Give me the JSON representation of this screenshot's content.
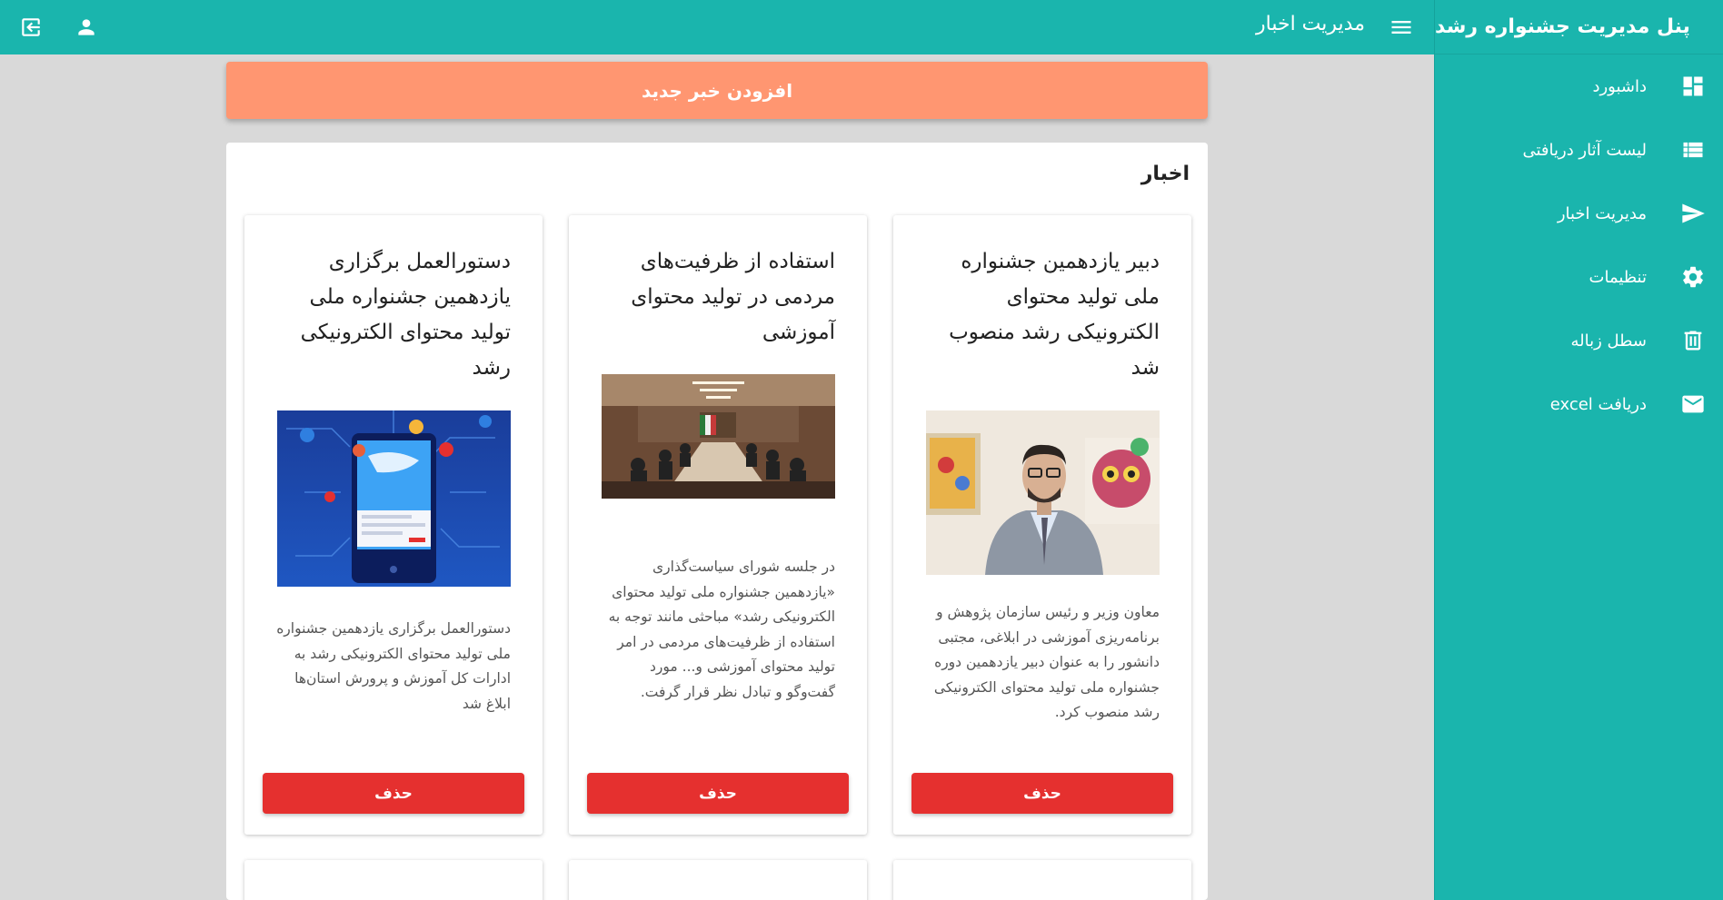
{
  "header": {
    "page_title": "مدیریت اخبار",
    "icons": [
      "menu-icon",
      "account-icon",
      "logout-icon"
    ]
  },
  "sidebar": {
    "brand": "پنل مدیریت جشنواره رشد",
    "items": [
      {
        "label": "داشبورد",
        "icon": "dashboard-icon"
      },
      {
        "label": "لیست آثار دریافتی",
        "icon": "list-icon"
      },
      {
        "label": "مدیریت اخبار",
        "icon": "send-icon"
      },
      {
        "label": "تنظیمات",
        "icon": "gear-icon"
      },
      {
        "label": "سطل زباله",
        "icon": "trash-icon"
      },
      {
        "label": "دریافت excel",
        "icon": "mail-icon"
      }
    ]
  },
  "main": {
    "add_button": "افزودن خبر جدید",
    "panel_title": "اخبار",
    "cards": [
      {
        "title": "دبیر یازدهمین جشنواره ملی تولید محتوای الکترونیکی رشد منصوب شد",
        "description": "معاون وزیر و رئیس سازمان پژوهش و برنامه‌ریزی آموزشی در ابلاغی، مجتبی دانشور را به عنوان دبیر یازدهمین دوره جشنواره ملی تولید محتوای الکترونیکی رشد منصوب کرد.",
        "delete_label": "حذف"
      },
      {
        "title": "استفاده از ظرفیت‌های مردمی در تولید محتوای آموزشی",
        "description": "در جلسه شورای سیاست‌گذاری «یازدهمین جشنواره ملی تولید محتوای الکترونیکی رشد» مباحثی مانند توجه به استفاده از ظرفیت‌های مردمی در امر تولید محتوای آموزشی و... مورد گفت‌وگو و تبادل نظر قرار گرفت.",
        "delete_label": "حذف"
      },
      {
        "title": "دستورالعمل برگزاری یازدهمین جشنواره ملی تولید محتوای الکترونیکی رشد",
        "description": "دستورالعمل برگزاری یازدهمین جشنواره ملی تولید محتوای الکترونیکی رشد به ادارات کل آموزش و پرورش استان‌ها ابلاغ شد",
        "delete_label": "حذف"
      }
    ]
  },
  "colors": {
    "primary": "#1ab5ad",
    "add_button": "#ff9671",
    "delete_button": "#e5302f",
    "background": "#d9d9d9"
  }
}
